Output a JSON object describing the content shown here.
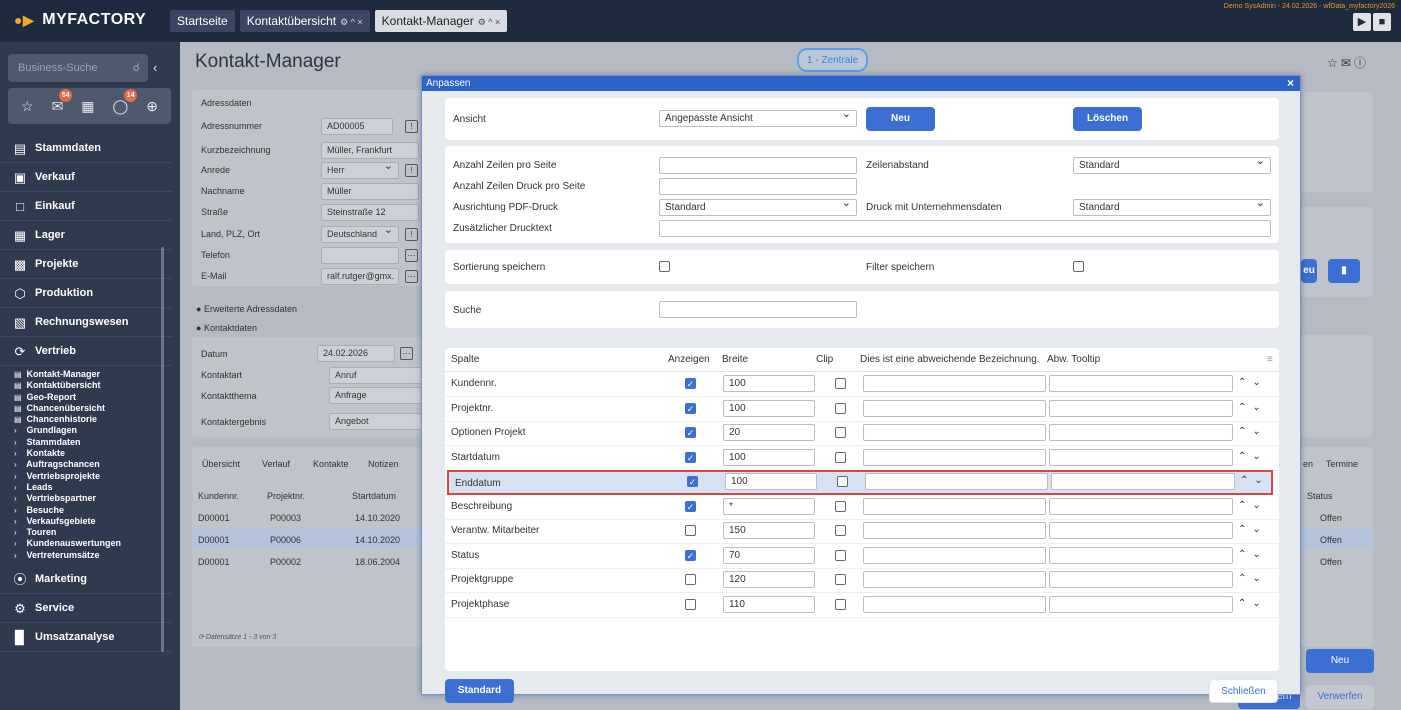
{
  "app": {
    "logo": "MYFACTORY",
    "demo_info": "Demo SysAdmin - 24.02.2026 - wfData_myfactory2026"
  },
  "tabs": [
    {
      "label": "Startseite"
    },
    {
      "label": "Kontaktübersicht",
      "icons": "⚙ ^ ×"
    },
    {
      "label": "Kontakt-Manager",
      "icons": "⚙ ^ ×"
    }
  ],
  "sidebar": {
    "search_placeholder": "Business-Suche",
    "badges": {
      "mail": "54",
      "tasks": "14"
    },
    "sections": {
      "stammdaten": "Stammdaten",
      "verkauf": "Verkauf",
      "einkauf": "Einkauf",
      "lager": "Lager",
      "projekte": "Projekte",
      "produktion": "Produktion",
      "rechnungswesen": "Rechnungswesen",
      "vertrieb": "Vertrieb",
      "marketing": "Marketing",
      "service": "Service",
      "umsatzanalyse": "Umsatzanalyse"
    },
    "vertrieb_items": [
      "Kontakt-Manager",
      "Kontaktübersicht",
      "Geo-Report",
      "Chancenübersicht",
      "Chancenhistorie",
      "Grundlagen",
      "Stammdaten",
      "Kontakte",
      "Auftragschancen",
      "Vertriebsprojekte",
      "Leads",
      "Vertriebspartner",
      "Besuche",
      "Verkaufsgebiete",
      "Touren",
      "Kundenauswertungen",
      "Vertreterumsätze"
    ]
  },
  "page": {
    "title": "Kontakt-Manager",
    "zentrale": "1 - Zentrale"
  },
  "adressdaten": {
    "heading": "Adressdaten",
    "fields": [
      {
        "label": "Adressnummer",
        "value": "AD00005"
      },
      {
        "label": "Kurzbezeichnung",
        "value": "Müller, Frankfurt"
      },
      {
        "label": "Anrede",
        "value": "Herr"
      },
      {
        "label": "Nachname",
        "value": "Müller"
      },
      {
        "label": "Straße",
        "value": "Steinstraße 12"
      },
      {
        "label": "Land, PLZ, Ort",
        "value": "Deutschland"
      },
      {
        "label": "Telefon",
        "value": ""
      },
      {
        "label": "E-Mail",
        "value": "ralf.rutger@gmx."
      }
    ],
    "erweiterte": "Erweiterte Adressdaten",
    "kontaktdaten": "Kontaktdaten"
  },
  "kontaktdaten": {
    "fields": [
      {
        "label": "Datum",
        "value": "24.02.2026"
      },
      {
        "label": "Kontaktart",
        "value": "Anruf"
      },
      {
        "label": "Kontaktthema",
        "value": "Anfrage"
      },
      {
        "label": "Kontaktergebnis",
        "value": "Angebot"
      }
    ]
  },
  "bottom_tabs": [
    "Übersicht",
    "Verlauf",
    "Kontakte",
    "Notizen"
  ],
  "right_tabs": [
    "en",
    "Termine"
  ],
  "bg_table": {
    "headers": [
      "Kundennr.",
      "Projektnr.",
      "Startdatum"
    ],
    "rows": [
      {
        "kunde": "D00001",
        "projekt": "P00003",
        "datum": "14.10.2020",
        "status": "Offen"
      },
      {
        "kunde": "D00001",
        "projekt": "P00006",
        "datum": "14.10.2020",
        "status": "Offen"
      },
      {
        "kunde": "D00001",
        "projekt": "P00002",
        "datum": "18.06.2004",
        "status": "Offen"
      }
    ],
    "status_header": "Status",
    "footer": "Datensätze 1 - 3 von 3"
  },
  "bg_buttons": {
    "neu": "Neu",
    "speichern": "Speichern",
    "verwerfen": "Verwerfen",
    "eu": "eu"
  },
  "dialog": {
    "title": "Anpassen",
    "ansicht_label": "Ansicht",
    "ansicht_value": "Angepasste Ansicht",
    "neu": "Neu",
    "loeschen": "Löschen",
    "zeilen_label": "Anzahl Zeilen pro Seite",
    "zeilen_druck_label": "Anzahl Zeilen Druck pro Seite",
    "ausrichtung_label": "Ausrichtung PDF-Druck",
    "ausrichtung_value": "Standard",
    "drucktext_label": "Zusätzlicher Drucktext",
    "zeilenabstand_label": "Zeilenabstand",
    "zeilenabstand_value": "Standard",
    "unternehmen_label": "Druck mit Unternehmensdaten",
    "unternehmen_value": "Standard",
    "sortierung_label": "Sortierung speichern",
    "filter_label": "Filter speichern",
    "suche_label": "Suche",
    "columns": {
      "spalte": "Spalte",
      "anzeigen": "Anzeigen",
      "breite": "Breite",
      "clip": "Clip",
      "bezeichnung": "Dies ist eine abweichende Bezeichnung.",
      "tooltip": "Abw. Tooltip"
    },
    "rows": [
      {
        "name": "Kundennr.",
        "show": true,
        "width": "100"
      },
      {
        "name": "Projektnr.",
        "show": true,
        "width": "100"
      },
      {
        "name": "Optionen Projekt",
        "show": true,
        "width": "20"
      },
      {
        "name": "Startdatum",
        "show": true,
        "width": "100"
      },
      {
        "name": "Enddatum",
        "show": true,
        "width": "100",
        "highlight": true
      },
      {
        "name": "Beschreibung",
        "show": true,
        "width": "*"
      },
      {
        "name": "Verantw. Mitarbeiter",
        "show": false,
        "width": "150"
      },
      {
        "name": "Status",
        "show": true,
        "width": "70"
      },
      {
        "name": "Projektgruppe",
        "show": false,
        "width": "120"
      },
      {
        "name": "Projektphase",
        "show": false,
        "width": "110"
      }
    ],
    "standard": "Standard",
    "schliessen": "Schließen"
  },
  "colors": {
    "accent": "#3c6fd4",
    "topbar": "#1e2a3e",
    "sidebar": "#2f3a4e",
    "highlight_border": "#d84545"
  }
}
